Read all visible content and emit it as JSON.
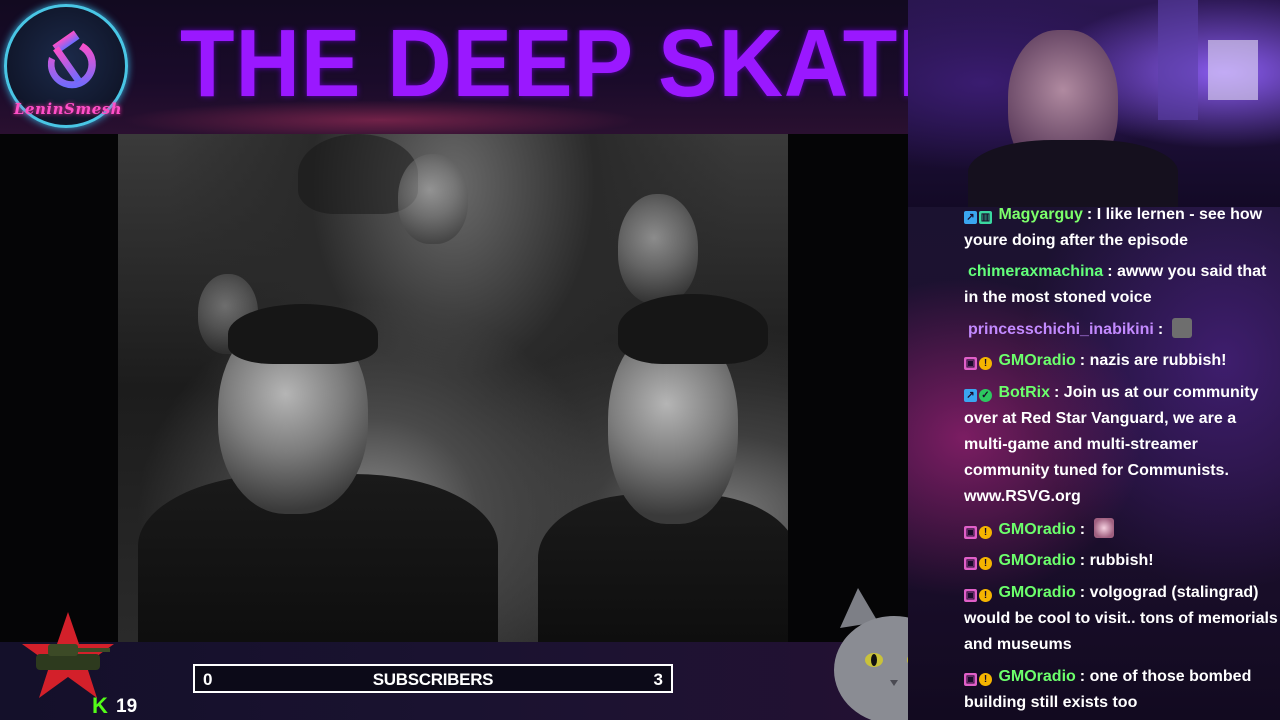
{
  "header": {
    "logo_text": "LeninSmesh",
    "title": "THE DEEP SKATE"
  },
  "stats": {
    "kick_count": "19",
    "subscribers": {
      "current": "0",
      "label": "SUBSCRIBERS",
      "goal": "3"
    }
  },
  "chat": {
    "messages": [
      {
        "user": "Magyarguy",
        "user_color": "#7cff6a",
        "text": "I like lernen - see how youre doing after the episode",
        "badges": [
          "blue-icon",
          "green-bars-icon"
        ]
      },
      {
        "user": "chimeraxmachina",
        "user_color": "#63ff7a",
        "text": "awww you said that in the most stoned voice",
        "badges": []
      },
      {
        "user": "princesschichi_inabikini",
        "user_color": "#c38aff",
        "text": "",
        "badges": [],
        "emote": "portrait-emote"
      },
      {
        "user": "GMOradio",
        "user_color": "#6cff6c",
        "text": "nazis are rubbish!",
        "badges": [
          "pink-icon",
          "coin-icon"
        ]
      },
      {
        "user": "BotRix",
        "user_color": "#6cff6c",
        "text": "Join us at our community over at Red Star Vanguard, we are a multi-game and multi-streamer community tuned for Communists. www.RSVG.org",
        "badges": [
          "blue-icon",
          "verified-icon"
        ]
      },
      {
        "user": "GMOradio",
        "user_color": "#6cff6c",
        "text": "",
        "badges": [
          "pink-icon",
          "coin-icon"
        ],
        "emote": "sparkle-emote"
      },
      {
        "user": "GMOradio",
        "user_color": "#6cff6c",
        "text": "rubbish!",
        "badges": [
          "pink-icon",
          "coin-icon"
        ]
      },
      {
        "user": "GMOradio",
        "user_color": "#6cff6c",
        "text": "volgograd (stalingrad) would be cool to visit.. tons of memorials and museums",
        "badges": [
          "pink-icon",
          "coin-icon"
        ]
      },
      {
        "user": "GMOradio",
        "user_color": "#6cff6c",
        "text": "one of those bombed building still exists too",
        "badges": [
          "pink-icon",
          "coin-icon"
        ]
      }
    ],
    "separator": ":"
  }
}
